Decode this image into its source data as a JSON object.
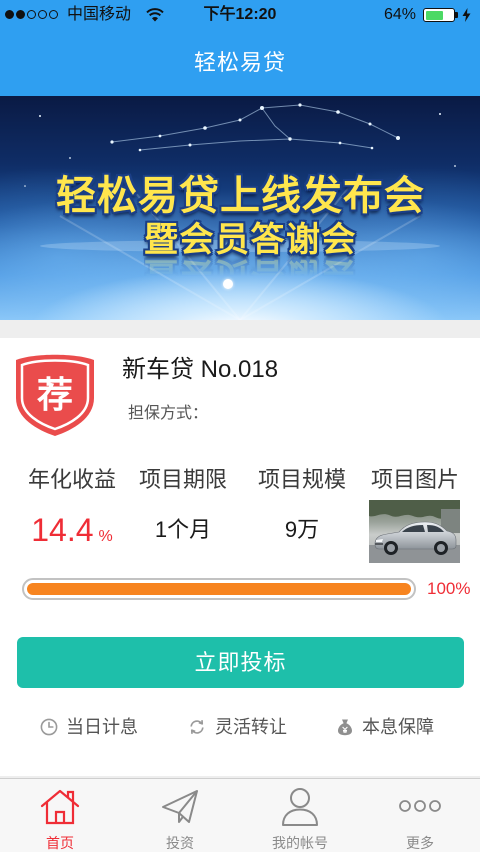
{
  "colors": {
    "brand_blue": "#2f9ff1",
    "accent_red": "#ef2d36",
    "progress_orange": "#f7841f",
    "button_teal": "#1ebfaa",
    "battery_green": "#4cd964"
  },
  "status_bar": {
    "signal_level": 2,
    "signal_max": 5,
    "carrier": "中国移动",
    "time": "下午12:20",
    "battery_label": "64%",
    "battery_level": 0.64,
    "charging": true
  },
  "nav": {
    "title": "轻松易贷"
  },
  "banner": {
    "headline": "轻松易贷上线发布会",
    "subheadline": "暨会员答谢会",
    "dots": 1,
    "active_dot": 0
  },
  "product": {
    "badge": "荐",
    "name": "新车贷 No.018",
    "guarantee_label": "担保方式：",
    "stats": [
      {
        "label": "年化收益",
        "value": "14.4",
        "unit": "%"
      },
      {
        "label": "项目期限",
        "value": "1个月"
      },
      {
        "label": "项目规模",
        "value": "9万"
      },
      {
        "label": "项目图片",
        "image": "silver-sedan-photo"
      }
    ],
    "progress_percent": 100,
    "progress_label": "100%",
    "invest_button": "立即投标",
    "features": [
      {
        "icon": "clock-icon",
        "label": "当日计息"
      },
      {
        "icon": "recycle-icon",
        "label": "灵活转让"
      },
      {
        "icon": "money-bag-icon",
        "label": "本息保障"
      }
    ]
  },
  "tabbar": {
    "active_index": 0,
    "tabs": [
      {
        "icon": "home-icon",
        "label": "首页"
      },
      {
        "icon": "paper-plane-icon",
        "label": "投资"
      },
      {
        "icon": "person-icon",
        "label": "我的帐号"
      },
      {
        "icon": "more-dots-icon",
        "label": "更多"
      }
    ]
  }
}
